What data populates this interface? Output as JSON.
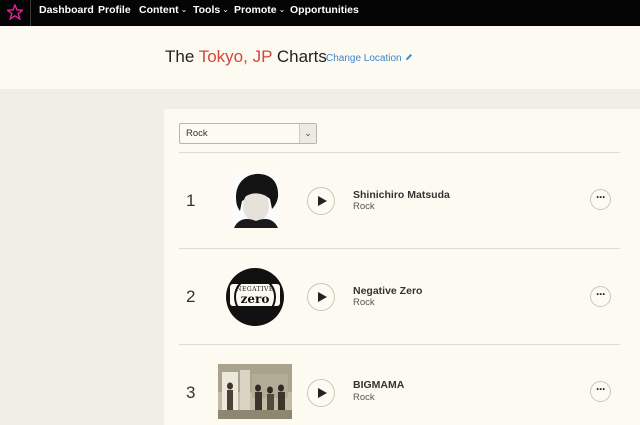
{
  "nav": {
    "items": [
      {
        "label": "Dashboard",
        "has_menu": false
      },
      {
        "label": "Profile",
        "has_menu": false
      },
      {
        "label": "Content",
        "has_menu": true
      },
      {
        "label": "Tools",
        "has_menu": true
      },
      {
        "label": "Promote",
        "has_menu": true
      },
      {
        "label": "Opportunities",
        "has_menu": false
      }
    ],
    "logo_color": "#e0239a"
  },
  "header": {
    "title_prefix": "The ",
    "title_location": "Tokyo, JP",
    "title_suffix": " Charts",
    "change_location": "Change Location"
  },
  "filter": {
    "selected_genre": "Rock"
  },
  "chart": [
    {
      "rank": "1",
      "artist": "Shinichiro Matsuda",
      "genre": "Rock"
    },
    {
      "rank": "2",
      "artist": "Negative Zero",
      "genre": "Rock",
      "logo_text_top": "NEGATIVE",
      "logo_text_main": "zero"
    },
    {
      "rank": "3",
      "artist": "BIGMAMA",
      "genre": "Rock"
    }
  ],
  "colors": {
    "accent_red": "#d8433c",
    "link_blue": "#3a86c8",
    "nav_bg": "#050505"
  }
}
